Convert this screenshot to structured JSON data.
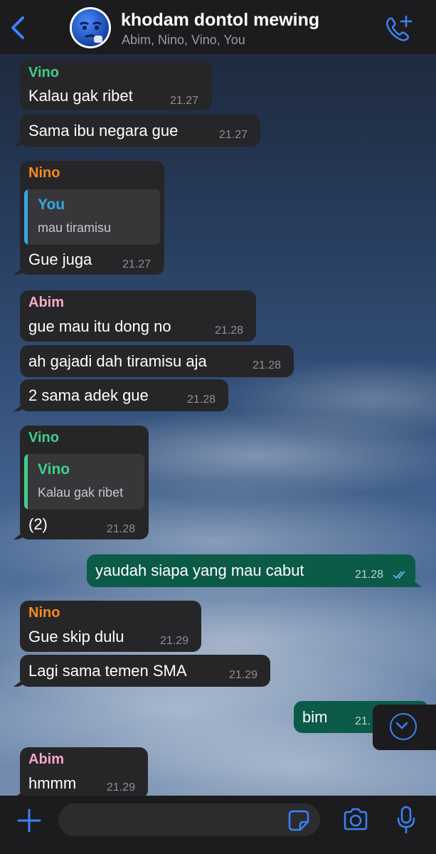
{
  "header": {
    "title": "khodam dontol mewing",
    "subtitle": "Abim, Nino, Vino, You"
  },
  "messages": [
    {
      "sender": "Vino",
      "text": "Kalau gak ribet",
      "time": "21.27"
    },
    {
      "text": "Sama ibu negara gue",
      "time": "21.27"
    },
    {
      "sender": "Nino",
      "quote_sender": "You",
      "quote_text": "mau tiramisu",
      "text": "Gue juga",
      "time": "21.27"
    },
    {
      "sender": "Abim",
      "text": "gue mau itu dong no",
      "time": "21.28"
    },
    {
      "text": "ah gajadi dah tiramisu aja",
      "time": "21.28"
    },
    {
      "text": "2 sama adek gue",
      "time": "21.28"
    },
    {
      "sender": "Vino",
      "quote_sender": "Vino",
      "quote_text": "Kalau gak ribet",
      "text": "(2)",
      "time": "21.28"
    },
    {
      "text": "yaudah siapa yang mau cabut",
      "time": "21.28",
      "outgoing": true
    },
    {
      "sender": "Nino",
      "text": "Gue skip dulu",
      "time": "21.29"
    },
    {
      "text": "Lagi sama temen SMA",
      "time": "21.29"
    },
    {
      "text": "bim",
      "time": "21.",
      "outgoing": true
    },
    {
      "sender": "Abim",
      "text": "hmmm",
      "time": "21.29"
    }
  ],
  "colors": {
    "vino": "#3fd08b",
    "nino": "#f58a1f",
    "abim": "#f6a9c8",
    "you": "#35a7e6",
    "accent": "#3b82f6",
    "outgoing_bubble": "#0c5a48",
    "incoming_bubble": "#262628"
  },
  "composer": {
    "value": ""
  },
  "icons": {
    "back": "chevron-left-icon",
    "call": "phone-plus-icon",
    "scroll": "chevron-down-icon",
    "attach": "plus-icon",
    "sticker": "sticker-icon",
    "camera": "camera-icon",
    "mic": "mic-icon"
  }
}
